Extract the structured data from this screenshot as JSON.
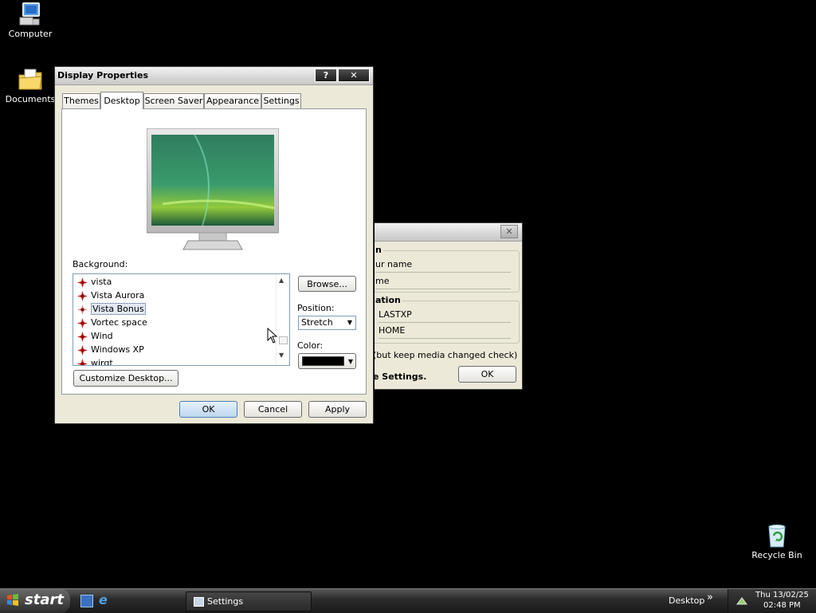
{
  "desktop": {
    "icons": [
      {
        "label": "Computer",
        "icon": "computer-icon"
      },
      {
        "label": "Documents",
        "icon": "documents-folder-icon"
      },
      {
        "label": "Recycle Bin",
        "icon": "recycle-bin-icon"
      }
    ]
  },
  "display_properties": {
    "title": "Display Properties",
    "help_btn": "?",
    "close_btn": "✕",
    "tabs": [
      "Themes",
      "Desktop",
      "Screen Saver",
      "Appearance",
      "Settings"
    ],
    "active_tab": "Desktop",
    "background_label": "Background:",
    "backgrounds": [
      "vista",
      "Vista Aurora",
      "Vista Bonus",
      "Vortec space",
      "Wind",
      "Windows XP",
      "wirgt"
    ],
    "selected_background": "Vista Bonus",
    "browse_label": "Browse...",
    "position_label": "Position:",
    "position_value": "Stretch",
    "color_label": "Color:",
    "color_value": "#000000",
    "customize_label": "Customize Desktop...",
    "ok_label": "OK",
    "cancel_label": "Cancel",
    "apply_label": "Apply"
  },
  "settings_dialog": {
    "close_btn": "✕",
    "group1_legend": "n",
    "field_name": "ur name",
    "field_name2": "me",
    "group2_legend": "ation",
    "field_computer": "LASTXP",
    "field_workgroup": "HOME",
    "check_text": "(but keep media changed check)",
    "footer_text": "e Settings.",
    "ok_label": "OK"
  },
  "taskbar": {
    "start_label": "start",
    "task_label": "Settings",
    "desktop_label": "Desktop",
    "chevron": "»",
    "clock_day": "Thu 13/02/25",
    "clock_time": "02:48 PM"
  }
}
